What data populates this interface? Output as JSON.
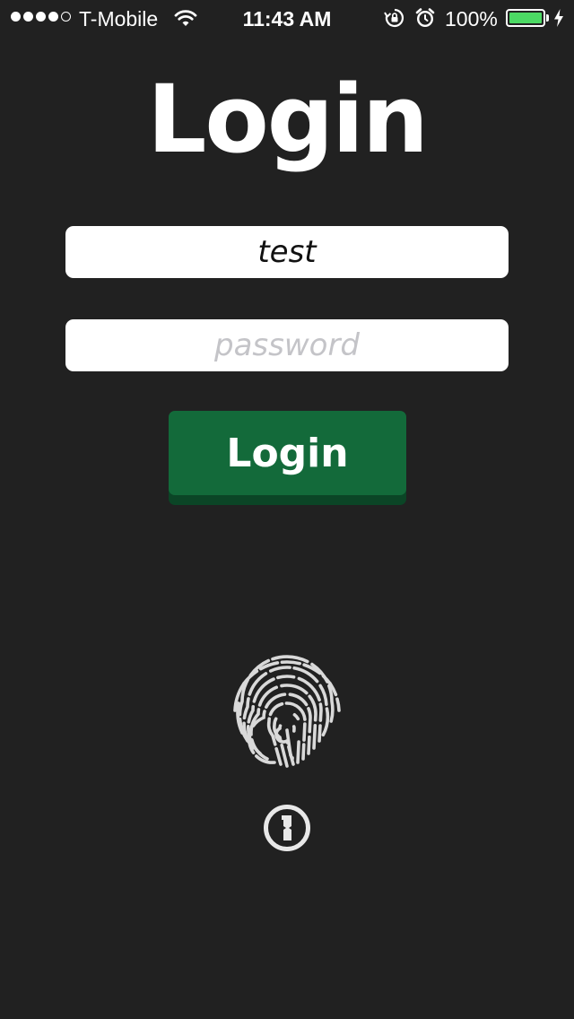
{
  "status_bar": {
    "signal_bars_filled": 4,
    "signal_bars_total": 5,
    "carrier": "T-Mobile",
    "wifi_icon": "wifi-icon",
    "time": "11:43 AM",
    "rotation_lock_icon": "rotation-lock-icon",
    "alarm_icon": "alarm-icon",
    "battery_percent": "100%",
    "battery_level": 1.0,
    "battery_color": "#4cd964",
    "charging_icon": "bolt-icon"
  },
  "title": "Login",
  "form": {
    "username": {
      "value": "test",
      "placeholder": ""
    },
    "password": {
      "value": "",
      "placeholder": "password"
    },
    "submit_label": "Login",
    "button_color": "#136a3a"
  },
  "extras": {
    "fingerprint_icon": "fingerprint-icon",
    "password_manager_icon": "onepassword-icon"
  },
  "colors": {
    "background": "#212121"
  }
}
